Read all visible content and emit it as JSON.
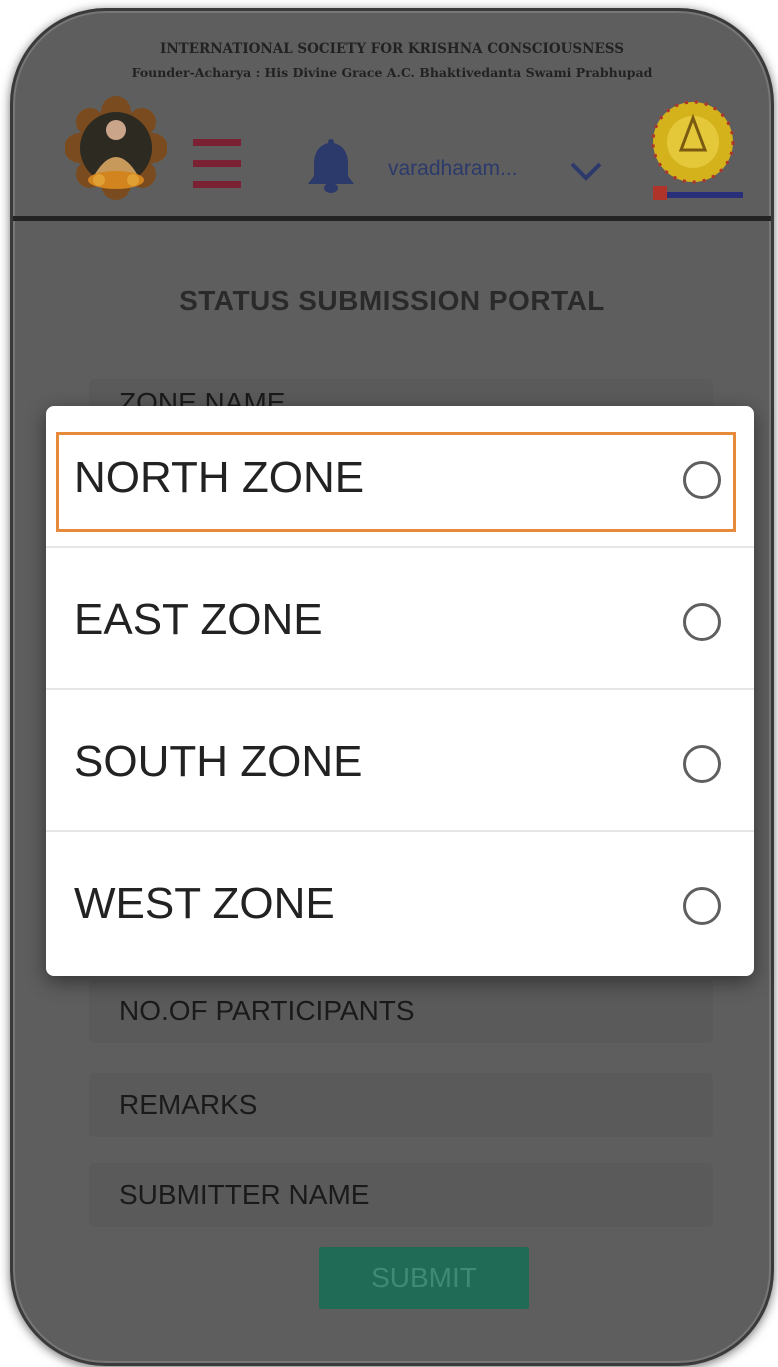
{
  "header": {
    "org_name": "INTERNATIONAL SOCIETY FOR KRISHNA CONSCIOUSNESS",
    "founder": "Founder-Acharya : His Divine Grace A.C. Bhaktivedanta Swami Prabhupad",
    "user_name": "varadharam...",
    "icons": [
      "prabhupada-logo",
      "menu-icon",
      "bell-icon",
      "chevron-down-icon",
      "emblem-logo"
    ]
  },
  "form": {
    "title": "STATUS SUBMISSION PORTAL",
    "zone_field_label": "ZONE NAME",
    "participants_label": "NO.OF PARTICIPANTS",
    "remarks_label": "REMARKS",
    "submitter_label": "SUBMITTER NAME",
    "submit_label": "SUBMIT"
  },
  "dropdown": {
    "options": [
      {
        "label": "NORTH ZONE",
        "selected": false,
        "focused": true
      },
      {
        "label": "EAST ZONE",
        "selected": false,
        "focused": false
      },
      {
        "label": "SOUTH ZONE",
        "selected": false,
        "focused": false
      },
      {
        "label": "WEST ZONE",
        "selected": false,
        "focused": false
      }
    ]
  },
  "colors": {
    "menu_accent": "#7a2134",
    "bell": "#2c3a6b",
    "submit_button": "#1f6b56",
    "focus_outline": "#e88a3c"
  }
}
